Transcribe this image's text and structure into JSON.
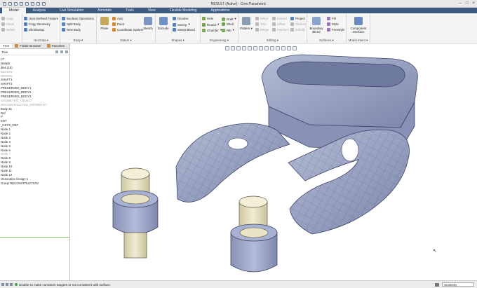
{
  "window": {
    "title": "RESULT (Active) - Creo Parametric"
  },
  "ribbon_tabs": [
    "Model",
    "Analysis",
    "Live Simulation",
    "Annotate",
    "Tools",
    "View",
    "Flexible Modeling",
    "Applications"
  ],
  "ribbon": {
    "get_data": {
      "items": [
        "User-Defined Feature",
        "Copy Geometry",
        "Shrinkwrap"
      ],
      "title": "Get Data"
    },
    "left_stub": {
      "items": [
        "Copy",
        "Paste",
        "Delete"
      ]
    },
    "body": {
      "items": [
        "Boolean Operations",
        "Split Body",
        "New Body"
      ],
      "title": "Body"
    },
    "datum": {
      "plane": "Plane",
      "items": [
        "Axis",
        "Point",
        "Coordinate System"
      ],
      "sketch": "Sketch",
      "title": "Datum"
    },
    "shapes": {
      "extrude": "Extrude",
      "items": [
        "Revolve",
        "Sweep",
        "Swept Blend"
      ],
      "title": "Shapes"
    },
    "engineering": {
      "col1": [
        "Hole",
        "Round",
        "Chamfer"
      ],
      "col2": [
        "Draft",
        "Shell",
        "Rib"
      ],
      "title": "Engineering"
    },
    "editing": {
      "pattern": "Pattern",
      "col1": [
        "Mirror",
        "Trim",
        "Merge"
      ],
      "col2": [
        "Extend",
        "Offset",
        "Intersect"
      ],
      "col3": [
        "Project",
        "Thicken",
        "Solidify"
      ],
      "title": "Editing"
    },
    "surfaces": {
      "boundary": "Boundary Blend",
      "items": [
        "Fill",
        "Style",
        "Freestyle"
      ],
      "title": "Surfaces"
    },
    "model_intent": {
      "component": "Component Interface",
      "title": "Model Intent"
    }
  },
  "left_panel": {
    "tabs": [
      "Tree",
      "Folder Browser",
      "Favorites"
    ],
    "header": "Tree",
    "rows": [
      {
        "text": "LT",
        "dim": false
      },
      {
        "text": "Details",
        "dim": false
      },
      {
        "text": "dies (15)",
        "dim": false
      },
      {
        "text": "DESIGN",
        "dim": true
      },
      {
        "text": "DESIGN",
        "dim": true
      },
      {
        "text": "SHAFT1",
        "dim": false
      },
      {
        "text": "SHAFT2",
        "dim": false
      },
      {
        "text": "PRESERVED_BODY1",
        "dim": false
      },
      {
        "text": "PRESERVED_BODY2",
        "dim": false
      },
      {
        "text": "PRESERVED_BODY3",
        "dim": false
      },
      {
        "text": "GEOMETRIC_OBJECT",
        "dim": true
      },
      {
        "text": "RECONSTRUCTED_GEOMETRY",
        "dim": true
      },
      {
        "text": "Body 16",
        "dim": false
      },
      {
        "text": "Ref",
        "dim": false
      },
      {
        "text": "P",
        "dim": false
      },
      {
        "text": "ENT",
        "dim": false
      },
      {
        "text": "_CSYS_DEF",
        "dim": false
      },
      {
        "text": "Node 1",
        "dim": false
      },
      {
        "text": "Node 2",
        "dim": false
      },
      {
        "text": "Node 3",
        "dim": false
      },
      {
        "text": "Node 4",
        "dim": false
      },
      {
        "text": "Node 5",
        "dim": false
      },
      {
        "text": "Node 6",
        "dim": false
      },
      {
        "text": "Node 7",
        "dim": true
      },
      {
        "text": "Node 8",
        "dim": false
      },
      {
        "text": "Node 9",
        "dim": false
      },
      {
        "text": "Node 10",
        "dim": false
      },
      {
        "text": "Node 11",
        "dim": false
      },
      {
        "text": "Node 12",
        "dim": false
      },
      {
        "text": "Generative Design 1",
        "dim": false
      },
      {
        "text": "Group RECONSTRUCTION",
        "dim": false
      }
    ]
  },
  "status": {
    "message": "Unable to make curvature tangent or G3 consistent with surface.",
    "filter": "Geometry"
  }
}
